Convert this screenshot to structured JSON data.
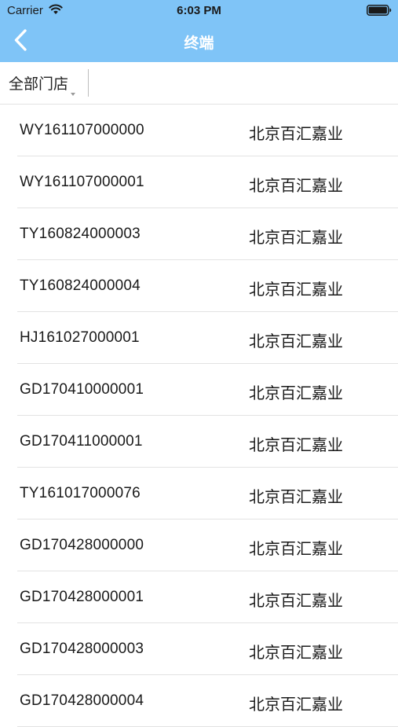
{
  "status_bar": {
    "carrier": "Carrier",
    "time": "6:03 PM",
    "wifi_icon": "wifi-icon",
    "battery_icon": "battery-icon"
  },
  "nav": {
    "back_icon": "chevron-left-icon",
    "title": "终端"
  },
  "filter": {
    "store_label": "全部门店",
    "dropdown_icon": "caret-down-icon"
  },
  "colors": {
    "header_background": "#7fc4f7",
    "title_text": "#ffffff",
    "divider": "#e3e3e3"
  },
  "terminals": [
    {
      "code": "WY161107000000",
      "store": "北京百汇嘉业"
    },
    {
      "code": "WY161107000001",
      "store": "北京百汇嘉业"
    },
    {
      "code": "TY160824000003",
      "store": "北京百汇嘉业"
    },
    {
      "code": "TY160824000004",
      "store": "北京百汇嘉业"
    },
    {
      "code": "HJ161027000001",
      "store": "北京百汇嘉业"
    },
    {
      "code": "GD170410000001",
      "store": "北京百汇嘉业"
    },
    {
      "code": "GD170411000001",
      "store": "北京百汇嘉业"
    },
    {
      "code": "TY161017000076",
      "store": "北京百汇嘉业"
    },
    {
      "code": "GD170428000000",
      "store": "北京百汇嘉业"
    },
    {
      "code": "GD170428000001",
      "store": "北京百汇嘉业"
    },
    {
      "code": "GD170428000003",
      "store": "北京百汇嘉业"
    },
    {
      "code": "GD170428000004",
      "store": "北京百汇嘉业"
    }
  ]
}
